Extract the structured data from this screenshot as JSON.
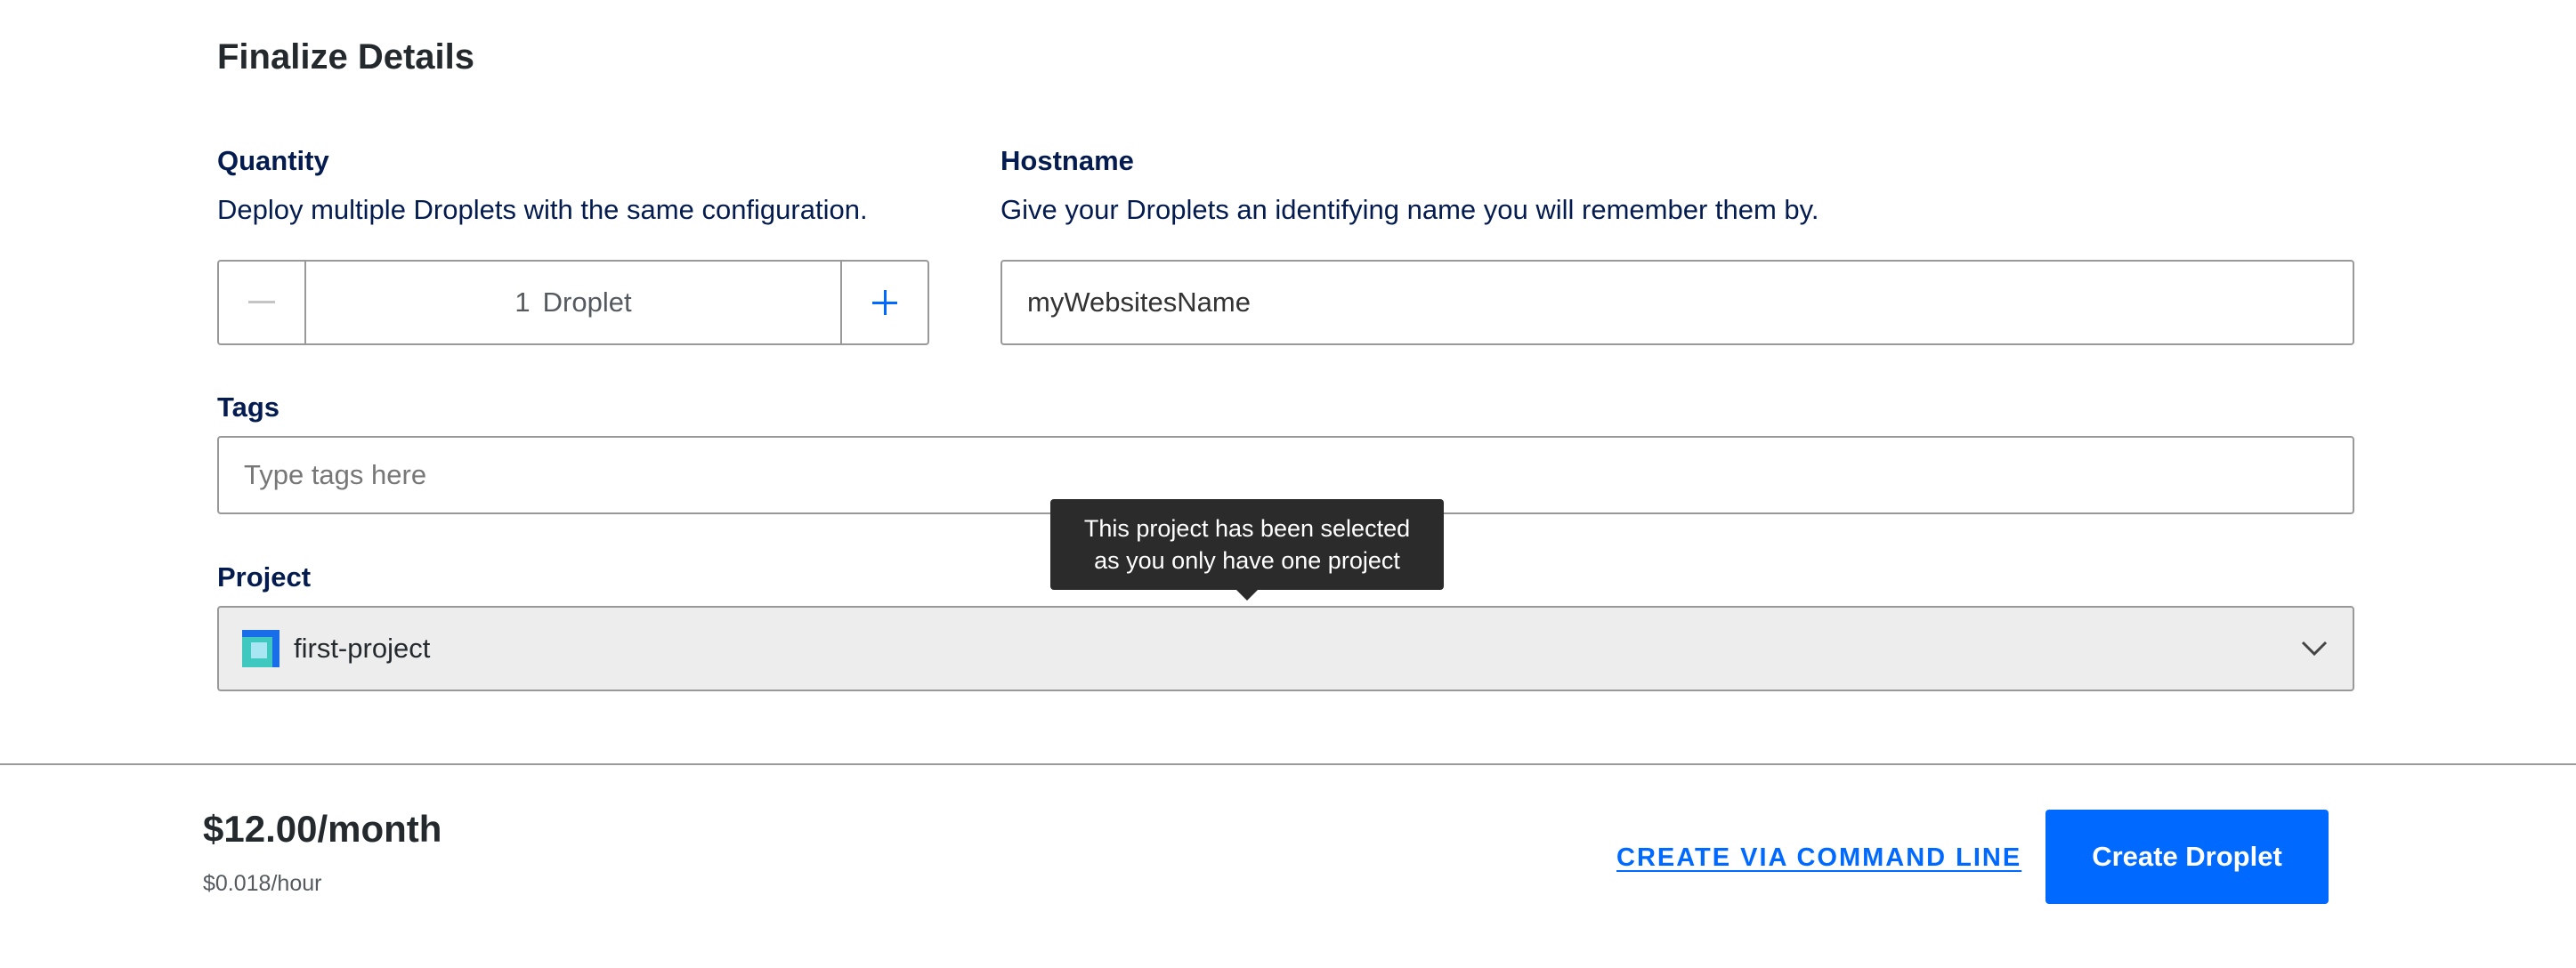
{
  "section": {
    "title": "Finalize Details"
  },
  "quantity": {
    "label": "Quantity",
    "help": "Deploy multiple Droplets with the same configuration.",
    "count": "1",
    "unit": "Droplet",
    "decrement_icon": "minus-icon",
    "increment_icon": "plus-icon"
  },
  "hostname": {
    "label": "Hostname",
    "help": "Give your Droplets an identifying name you will remember them by.",
    "value": "myWebsitesName"
  },
  "tags": {
    "label": "Tags",
    "placeholder": "Type tags here",
    "value": ""
  },
  "project": {
    "label": "Project",
    "selected": "first-project",
    "icon": "project-icon",
    "tooltip": "This project has been selected as you only have one project"
  },
  "footer": {
    "price": "$12.00/month",
    "hourly": "$0.018/hour",
    "cli_link": "CREATE VIA COMMAND LINE",
    "create_button": "Create Droplet"
  },
  "colors": {
    "accent": "#0069ff",
    "text": "#031b4e",
    "tooltip_bg": "#2b2b2b",
    "disabled_select_bg": "#ededed"
  }
}
